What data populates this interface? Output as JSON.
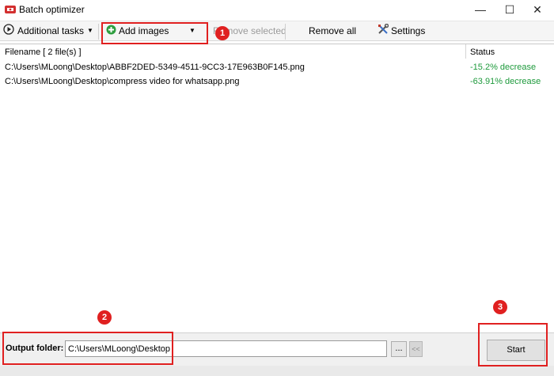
{
  "window": {
    "title": "Batch optimizer",
    "app_icon": "batch-optimizer-app-icon",
    "controls": {
      "minimize": "—",
      "maximize": "☐",
      "close": "✕"
    }
  },
  "toolbar": {
    "additional_tasks": {
      "label": "Additional tasks",
      "icon": "play-circle-icon",
      "arrow": "▼"
    },
    "add_images": {
      "label": "Add images",
      "icon": "green-plus-icon",
      "arrow": "▼"
    },
    "remove_selected": {
      "label": "Remove selected",
      "enabled": false
    },
    "remove_all": {
      "label": "Remove all"
    },
    "settings": {
      "label": "Settings",
      "icon": "tools-icon"
    }
  },
  "file_list": {
    "columns": {
      "filename": "Filename [ 2 file(s) ]",
      "status": "Status"
    },
    "rows": [
      {
        "filename": "C:\\Users\\MLoong\\Desktop\\ABBF2DED-5349-4511-9CC3-17E963B0F145.png",
        "status": "-15.2% decrease"
      },
      {
        "filename": "C:\\Users\\MLoong\\Desktop\\compress video for whatsapp.png",
        "status": "-63.91% decrease"
      }
    ],
    "status_color": "#1e9a3c"
  },
  "output": {
    "label": "Output folder:",
    "value": "C:\\Users\\MLoong\\Desktop",
    "browse_label": "...",
    "back_label": "<<"
  },
  "actions": {
    "start_label": "Start"
  },
  "annotations": {
    "badge_1": "1",
    "badge_2": "2",
    "badge_3": "3",
    "color": "#e02020"
  }
}
